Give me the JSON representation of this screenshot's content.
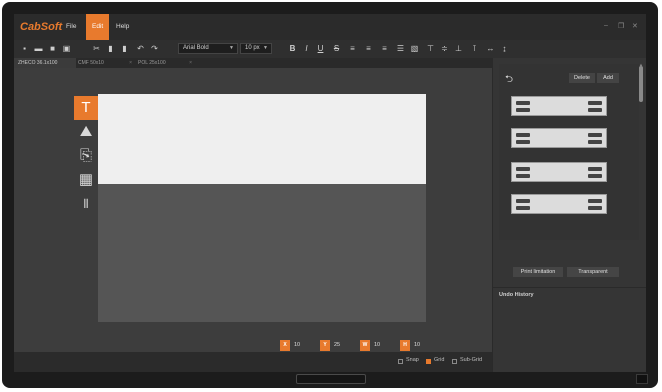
{
  "app": {
    "logo": "CabSoft"
  },
  "menu": {
    "file": "File",
    "edit": "Edit",
    "help": "Help"
  },
  "window": {
    "minimize": "–",
    "restore": "❐",
    "close": "✕"
  },
  "toolbar": {
    "font_family": "Arial Bold",
    "font_size": "10 px",
    "icons": [
      "new-icon",
      "open-icon",
      "save-icon",
      "print-icon",
      "cut-icon",
      "copy-icon",
      "paste-icon",
      "undo-icon",
      "redo-icon",
      "bold-icon",
      "italic-icon",
      "underline-icon",
      "strikethrough-icon",
      "align-left-icon",
      "align-center-icon",
      "align-right-icon",
      "justify-icon",
      "image-align-icon",
      "align-top-icon",
      "align-middle-icon",
      "align-bottom-icon",
      "text-direction-icon",
      "text-width-icon",
      "text-height-icon"
    ]
  },
  "tabs": [
    {
      "label": "ZHECO 36.1x100"
    },
    {
      "label": "CMF 50x10"
    },
    {
      "label": "POL 25x100"
    }
  ],
  "tools": [
    "text-tool-icon",
    "image-tool-icon",
    "import-tool-icon",
    "date-tool-icon",
    "barcode-tool-icon"
  ],
  "coords": {
    "x_badge": "X",
    "x_value": "10 mm",
    "y_badge": "Y",
    "y_value": "25 mm",
    "w_badge": "W",
    "w_value": "10 mm",
    "h_badge": "H",
    "h_value": "10 mm"
  },
  "status": {
    "snap": "Snap",
    "grid": "Grid",
    "subgrid": "Sub-Grid"
  },
  "panel": {
    "delete": "Delete",
    "add": "Add",
    "print_limitation": "Print limitation",
    "transparent": "Transparent",
    "undo_history": "Undo History"
  },
  "colors": {
    "accent": "#e87a2d",
    "background": "#3c3c3c",
    "label": "#efefef"
  }
}
